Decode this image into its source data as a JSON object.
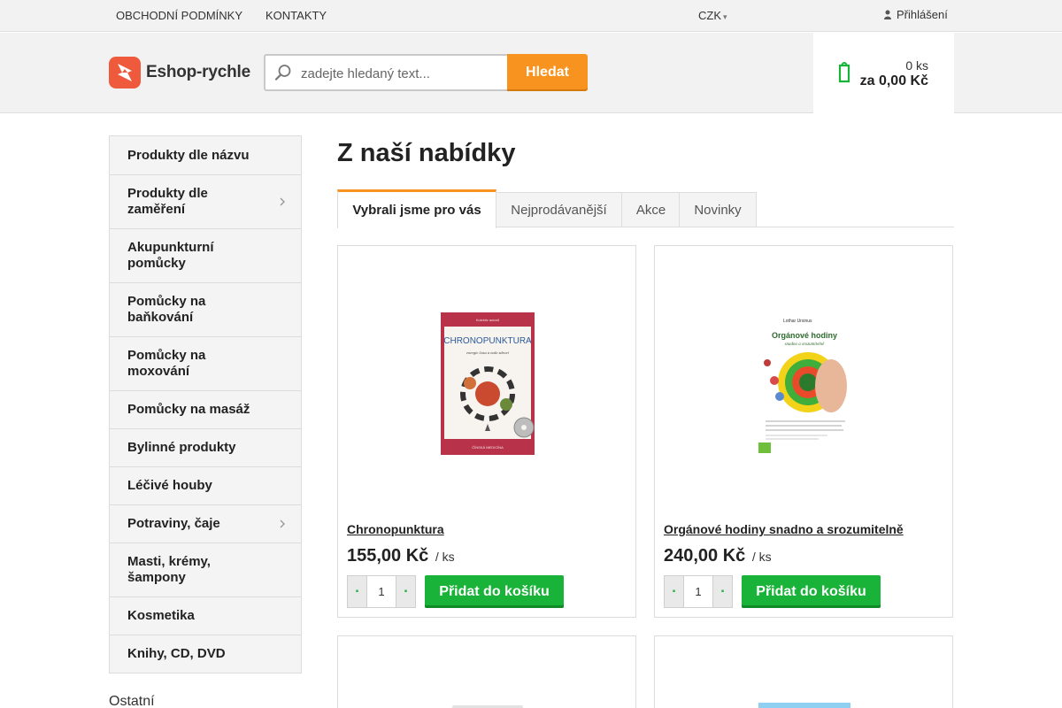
{
  "topbar": {
    "links": [
      "OBCHODNÍ PODMÍNKY",
      "KONTAKTY"
    ],
    "currency": "CZK",
    "login": "Přihlášení"
  },
  "header": {
    "logo_text": "Eshop-rychle",
    "search": {
      "placeholder": "zadejte hledaný text...",
      "value": "",
      "button": "Hledat"
    },
    "cart": {
      "qty": "0 ks",
      "total": "za 0,00 Kč"
    },
    "accent": "#f7931e",
    "green": "#19b33a"
  },
  "sidebar": {
    "items": [
      {
        "label": "Produkty dle názvu",
        "has_arrow": false
      },
      {
        "label": "Produkty dle zaměření",
        "has_arrow": true
      },
      {
        "label": "Akupunkturní pomůcky",
        "has_arrow": false
      },
      {
        "label": "Pomůcky na baňkování",
        "has_arrow": false
      },
      {
        "label": "Pomůcky na moxování",
        "has_arrow": false
      },
      {
        "label": "Pomůcky na masáž",
        "has_arrow": false
      },
      {
        "label": "Bylinné produkty",
        "has_arrow": false
      },
      {
        "label": "Léčivé houby",
        "has_arrow": false
      },
      {
        "label": "Potraviny, čaje",
        "has_arrow": true
      },
      {
        "label": "Masti, krémy, šampony",
        "has_arrow": false
      },
      {
        "label": "Kosmetika",
        "has_arrow": false
      },
      {
        "label": "Knihy, CD, DVD",
        "has_arrow": false
      }
    ],
    "other_heading": "Ostatní"
  },
  "main": {
    "title": "Z naší nabídky",
    "tabs": [
      {
        "label": "Vybrali jsme pro vás",
        "active": true
      },
      {
        "label": "Nejprodávanější",
        "active": false
      },
      {
        "label": "Akce",
        "active": false
      },
      {
        "label": "Novinky",
        "active": false
      }
    ],
    "products": [
      {
        "name": "Chronopunktura",
        "price": "155,00 Kč",
        "unit": "/ ks",
        "qty": "1",
        "button": "Přidat do košíku",
        "cover": {
          "title": "CHRONOPUNKTURA",
          "subtitle": "energie času a naše zdraví",
          "top": "Kolektiv autorů",
          "bottom": "ČÍNSKÁ MEDICÍNA",
          "bg": "#b8324a"
        }
      },
      {
        "name": "Orgánové hodiny snadno a srozumitelně",
        "price": "240,00 Kč",
        "unit": "/ ks",
        "qty": "1",
        "button": "Přidat do košíku",
        "cover": {
          "author": "Lothar Ursinus",
          "title": "Orgánové hodiny",
          "subtitle": "snadno a srozumitelně"
        }
      }
    ]
  }
}
